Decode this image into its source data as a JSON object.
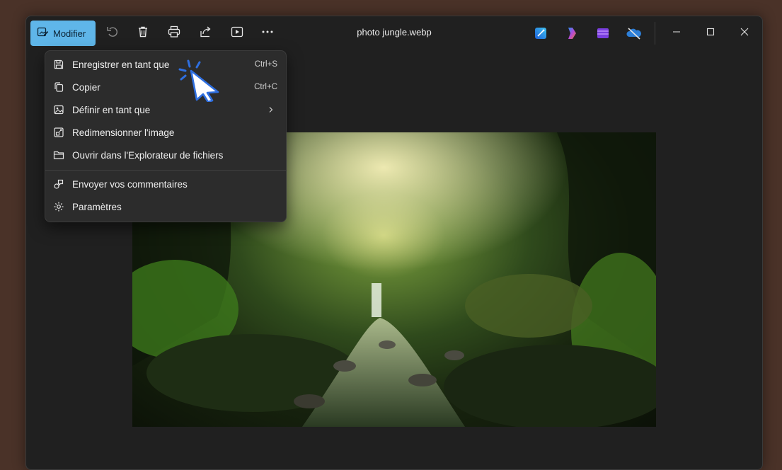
{
  "window": {
    "title": "photo jungle.webp"
  },
  "toolbar": {
    "modifier_label": "Modifier",
    "icons": [
      "edit-image-icon",
      "rotate-icon",
      "delete-icon",
      "print-icon",
      "share-icon",
      "slideshow-icon",
      "more-icon"
    ],
    "apps": [
      "designer-app-icon",
      "copilot-app-icon",
      "clipchamp-app-icon",
      "onedrive-app-icon"
    ]
  },
  "menu": {
    "items": [
      {
        "label": "Enregistrer en tant que",
        "shortcut": "Ctrl+S"
      },
      {
        "label": "Copier",
        "shortcut": "Ctrl+C"
      },
      {
        "label": "Définir en tant que",
        "shortcut": ""
      },
      {
        "label": "Redimensionner l'image",
        "shortcut": ""
      },
      {
        "label": "Ouvrir dans l'Explorateur de fichiers",
        "shortcut": ""
      },
      {
        "label": "Envoyer vos commentaires",
        "shortcut": ""
      },
      {
        "label": "Paramètres",
        "shortcut": ""
      }
    ]
  },
  "colors": {
    "accent": "#5fb6e9",
    "background": "#202020",
    "menu": "#2c2c2c",
    "desktop": "#4a3228",
    "cursor": "#2f6fe0"
  }
}
